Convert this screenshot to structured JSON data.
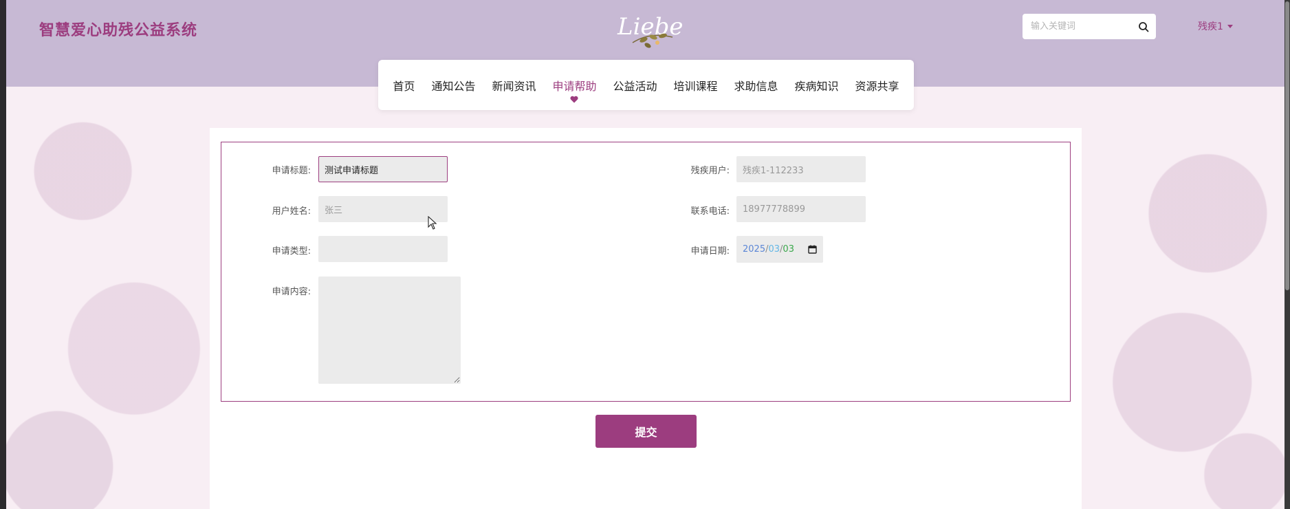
{
  "header": {
    "site_title": "智慧爱心助残公益系统",
    "logo_text": "Liebe",
    "search_placeholder": "输入关键词",
    "user_name": "残疾1"
  },
  "nav": {
    "items": [
      {
        "label": "首页",
        "active": false
      },
      {
        "label": "通知公告",
        "active": false
      },
      {
        "label": "新闻资讯",
        "active": false
      },
      {
        "label": "申请帮助",
        "active": true
      },
      {
        "label": "公益活动",
        "active": false
      },
      {
        "label": "培训课程",
        "active": false
      },
      {
        "label": "求助信息",
        "active": false
      },
      {
        "label": "疾病知识",
        "active": false
      },
      {
        "label": "资源共享",
        "active": false
      }
    ]
  },
  "form": {
    "title_label": "申请标题:",
    "title_value": "测试申请标题",
    "disabled_user_label": "残疾用户:",
    "disabled_user_value": "残疾1-112233",
    "name_label": "用户姓名:",
    "name_value": "张三",
    "phone_label": "联系电话:",
    "phone_value": "18977778899",
    "type_label": "申请类型:",
    "type_value": "",
    "date_label": "申请日期:",
    "date_year": "2025",
    "date_month": "03",
    "date_day": "03",
    "date_sep": "/",
    "content_label": "申请内容:",
    "content_value": "",
    "submit_label": "提交"
  },
  "colors": {
    "accent": "#9c3d7f",
    "header_bg": "#c7b9d4",
    "field_bg": "#ebebeb"
  }
}
